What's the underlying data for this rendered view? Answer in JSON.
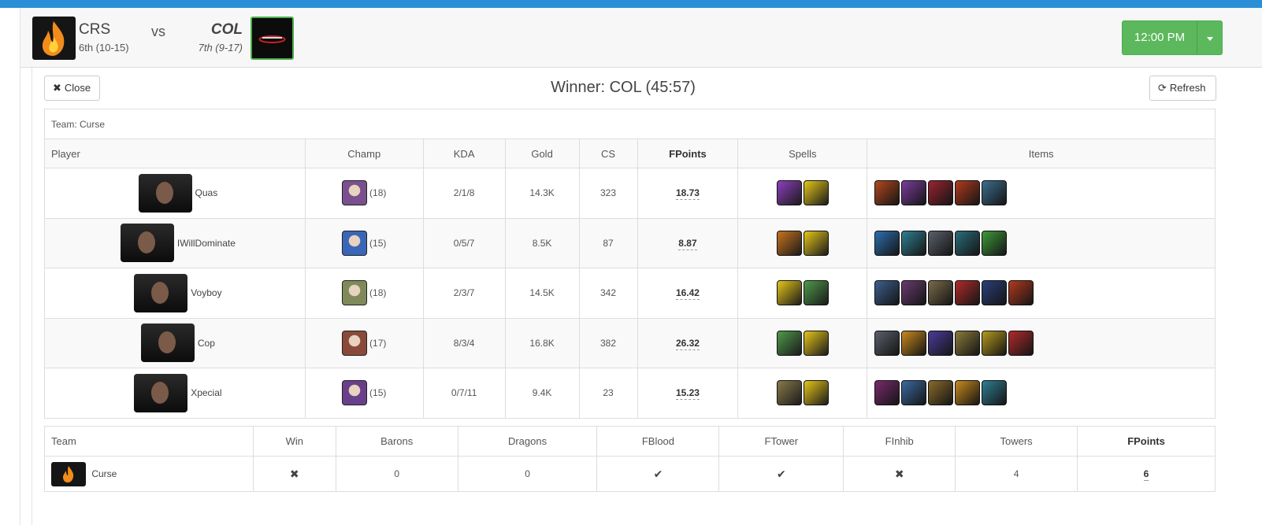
{
  "match": {
    "home": {
      "abbr": "CRS",
      "record": "6th (10-15)"
    },
    "vs": "vs",
    "away": {
      "abbr": "COL",
      "record": "7th (9-17)"
    },
    "time": "12:00 PM"
  },
  "toolbar": {
    "close_label": "Close",
    "refresh_label": "Refresh",
    "winner": "Winner: COL (45:57)"
  },
  "team_caption": "Team: Curse",
  "player_headers": [
    "Player",
    "Champ",
    "KDA",
    "Gold",
    "CS",
    "FPoints",
    "Spells",
    "Items"
  ],
  "players": [
    {
      "name": "Quas",
      "level": "(18)",
      "kda": "2/1/8",
      "gold": "14.3K",
      "cs": "323",
      "fpoints": "18.73",
      "champ_color": "#7a4f8f",
      "spells": [
        "#8e3fbf",
        "#e6c619"
      ],
      "items": [
        "#b5471c",
        "#7c3c9e",
        "#9a2430",
        "#b33a1e",
        "#3c6e8f"
      ]
    },
    {
      "name": "IWillDominate",
      "level": "(15)",
      "kda": "0/5/7",
      "gold": "8.5K",
      "cs": "87",
      "fpoints": "8.87",
      "champ_color": "#3a66b8",
      "spells": [
        "#c9731d",
        "#e6c619"
      ],
      "items": [
        "#2c6fb0",
        "#2f7f93",
        "#5a5f6a",
        "#2a6d7a",
        "#3e9a3a"
      ]
    },
    {
      "name": "Voyboy",
      "level": "(18)",
      "kda": "2/3/7",
      "gold": "14.5K",
      "cs": "342",
      "fpoints": "16.42",
      "champ_color": "#7f8a5a",
      "spells": [
        "#e6c619",
        "#4f9a4a"
      ],
      "items": [
        "#3c5f8f",
        "#6a3b6e",
        "#7a6a4a",
        "#b22a2a",
        "#2a3f7a",
        "#b33a1e"
      ]
    },
    {
      "name": "Cop",
      "level": "(17)",
      "kda": "8/3/4",
      "gold": "16.8K",
      "cs": "382",
      "fpoints": "26.32",
      "champ_color": "#8a4a3a",
      "spells": [
        "#4f9a4a",
        "#e6c619"
      ],
      "items": [
        "#5a5f6a",
        "#c98a1d",
        "#4a3c9a",
        "#8a7a3a",
        "#b59a1d",
        "#b22a2a"
      ]
    },
    {
      "name": "Xpecial",
      "level": "(15)",
      "kda": "0/7/11",
      "gold": "9.4K",
      "cs": "23",
      "fpoints": "15.23",
      "champ_color": "#6a3f8a",
      "spells": [
        "#8a7a4a",
        "#e6c619"
      ],
      "items": [
        "#7a2a6e",
        "#3a6aa0",
        "#8a6a2a",
        "#c98a1d",
        "#2f7f93"
      ]
    }
  ],
  "team_headers": [
    "Team",
    "Win",
    "Barons",
    "Dragons",
    "FBlood",
    "FTower",
    "FInhib",
    "Towers",
    "FPoints"
  ],
  "team_row": {
    "name": "Curse",
    "win_icon": "times-icon",
    "barons": "0",
    "dragons": "0",
    "fblood_icon": "check-icon",
    "ftower_icon": "check-icon",
    "finhib_icon": "times-icon",
    "towers": "4",
    "fpoints": "6"
  },
  "symbols": {
    "check": "✔",
    "times": "✖",
    "close": "✖",
    "refresh": "⟳"
  },
  "colors": {
    "accent_blue": "#2a8fd6",
    "time_green": "#5cb85c",
    "col_border": "#4cae4c"
  }
}
